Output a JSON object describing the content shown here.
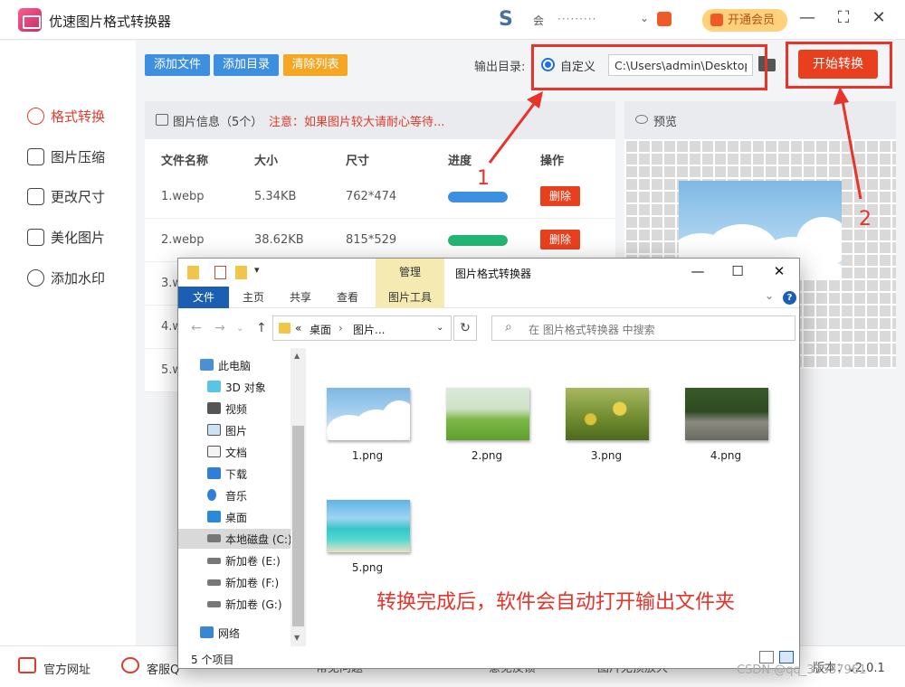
{
  "app": {
    "title": "优速图片格式转换器",
    "user_name": "会",
    "user_masked": "·········",
    "vip_label": "开通会员"
  },
  "sidebar": {
    "items": [
      {
        "label": "格式转换",
        "icon": "convert-icon",
        "active": true
      },
      {
        "label": "图片压缩",
        "icon": "compress-icon",
        "active": false
      },
      {
        "label": "更改尺寸",
        "icon": "resize-icon",
        "active": false
      },
      {
        "label": "美化图片",
        "icon": "beautify-icon",
        "active": false
      },
      {
        "label": "添加水印",
        "icon": "watermark-icon",
        "active": false
      }
    ]
  },
  "toolbar": {
    "add_file": "添加文件",
    "add_dir": "添加目录",
    "clear_list": "清除列表",
    "output_label": "输出目录:",
    "custom_label": "自定义",
    "output_path": "C:\\Users\\admin\\Desktop",
    "start_label": "开始转换",
    "colors": {
      "add": "#3d8fe0",
      "clear": "#f5a623",
      "start": "#e8401f"
    }
  },
  "file_list": {
    "info_label": "图片信息（5个）",
    "notice": "注意：如果图片较大请耐心等待...",
    "columns": [
      "文件名称",
      "大小",
      "尺寸",
      "进度",
      "操作"
    ],
    "rows": [
      {
        "name": "1.webp",
        "size": "5.34KB",
        "dims": "762*474",
        "progress": 1.0,
        "color": "#3d8fe0",
        "action": "删除"
      },
      {
        "name": "2.webp",
        "size": "38.62KB",
        "dims": "815*529",
        "progress": 1.0,
        "color": "#22b573",
        "action": "删除"
      },
      {
        "name": "3.w"
      },
      {
        "name": "4.w"
      },
      {
        "name": "5.w"
      }
    ]
  },
  "preview": {
    "label": "预览"
  },
  "annotations": {
    "one": "1",
    "two": "2"
  },
  "explorer": {
    "manage_tab": "管理",
    "title": "图片格式转换器",
    "ribbon_tabs": [
      "文件",
      "主页",
      "共享",
      "查看",
      "图片工具"
    ],
    "address": [
      "«",
      "桌面",
      "›",
      "图片..."
    ],
    "search_placeholder": "在 图片格式转换器 中搜索",
    "nav": [
      {
        "label": "此电脑",
        "icon": "pc-icon"
      },
      {
        "label": "3D 对象",
        "icon": "cube-icon"
      },
      {
        "label": "视频",
        "icon": "video-icon"
      },
      {
        "label": "图片",
        "icon": "pictures-icon"
      },
      {
        "label": "文档",
        "icon": "document-icon"
      },
      {
        "label": "下载",
        "icon": "download-icon"
      },
      {
        "label": "音乐",
        "icon": "music-icon"
      },
      {
        "label": "桌面",
        "icon": "desktop-icon"
      },
      {
        "label": "本地磁盘 (C:)",
        "icon": "drive-icon",
        "selected": true
      },
      {
        "label": "新加卷 (E:)",
        "icon": "drive-icon"
      },
      {
        "label": "新加卷 (F:)",
        "icon": "drive-icon"
      },
      {
        "label": "新加卷 (G:)",
        "icon": "drive-icon"
      },
      {
        "label": "网络",
        "icon": "network-icon"
      }
    ],
    "files": [
      "1.png",
      "2.png",
      "3.png",
      "4.png",
      "5.png"
    ],
    "caption": "转换完成后，软件会自动打开输出文件夹",
    "status_count": "5 个项目"
  },
  "bottom": {
    "site": "官方网址",
    "service": "客服Q",
    "version": "版本：v2.0.1",
    "dim_items": [
      "常见问题",
      "意见反馈",
      "图片无损放大"
    ],
    "watermark": "CSDN @qq_33537961"
  }
}
